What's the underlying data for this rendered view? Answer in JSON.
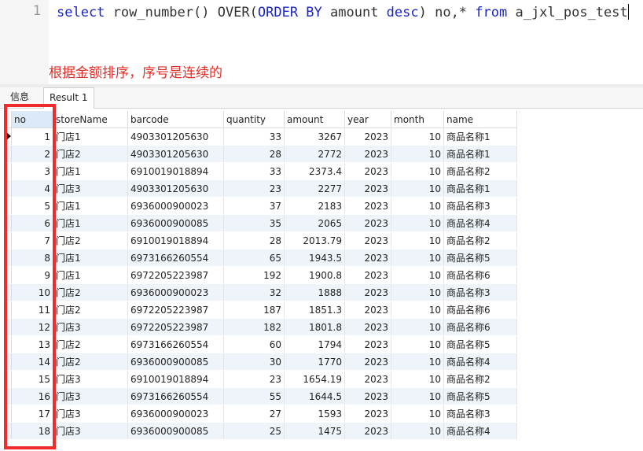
{
  "editor": {
    "line_number": "1",
    "code": {
      "t1": "select",
      "t2": " row_number() OVER(",
      "t3": "ORDER BY",
      "t4": " amount ",
      "t5": "desc",
      "t6": ") no,* ",
      "t7": "from",
      "t8": " a_jxl_pos_test"
    },
    "annotation": "根据金额排序，序号是连续的"
  },
  "tabs": {
    "info": "信息",
    "result": "Result 1"
  },
  "grid": {
    "columns": [
      "no",
      "storeName",
      "barcode",
      "quantity",
      "amount",
      "year",
      "month",
      "name"
    ],
    "rows": [
      [
        "1",
        "门店1",
        "4903301205630",
        "33",
        "3267",
        "2023",
        "10",
        "商品名称1"
      ],
      [
        "2",
        "门店2",
        "4903301205630",
        "28",
        "2772",
        "2023",
        "10",
        "商品名称1"
      ],
      [
        "3",
        "门店1",
        "6910019018894",
        "33",
        "2373.4",
        "2023",
        "10",
        "商品名称2"
      ],
      [
        "4",
        "门店3",
        "4903301205630",
        "23",
        "2277",
        "2023",
        "10",
        "商品名称1"
      ],
      [
        "5",
        "门店1",
        "6936000900023",
        "37",
        "2183",
        "2023",
        "10",
        "商品名称3"
      ],
      [
        "6",
        "门店1",
        "6936000900085",
        "35",
        "2065",
        "2023",
        "10",
        "商品名称4"
      ],
      [
        "7",
        "门店2",
        "6910019018894",
        "28",
        "2013.79",
        "2023",
        "10",
        "商品名称2"
      ],
      [
        "8",
        "门店1",
        "6973166260554",
        "65",
        "1943.5",
        "2023",
        "10",
        "商品名称5"
      ],
      [
        "9",
        "门店1",
        "6972205223987",
        "192",
        "1900.8",
        "2023",
        "10",
        "商品名称6"
      ],
      [
        "10",
        "门店2",
        "6936000900023",
        "32",
        "1888",
        "2023",
        "10",
        "商品名称3"
      ],
      [
        "11",
        "门店2",
        "6972205223987",
        "187",
        "1851.3",
        "2023",
        "10",
        "商品名称6"
      ],
      [
        "12",
        "门店3",
        "6972205223987",
        "182",
        "1801.8",
        "2023",
        "10",
        "商品名称6"
      ],
      [
        "13",
        "门店2",
        "6973166260554",
        "60",
        "1794",
        "2023",
        "10",
        "商品名称5"
      ],
      [
        "14",
        "门店2",
        "6936000900085",
        "30",
        "1770",
        "2023",
        "10",
        "商品名称4"
      ],
      [
        "15",
        "门店3",
        "6910019018894",
        "23",
        "1654.19",
        "2023",
        "10",
        "商品名称2"
      ],
      [
        "16",
        "门店3",
        "6973166260554",
        "55",
        "1644.5",
        "2023",
        "10",
        "商品名称5"
      ],
      [
        "17",
        "门店3",
        "6936000900023",
        "27",
        "1593",
        "2023",
        "10",
        "商品名称3"
      ],
      [
        "18",
        "门店3",
        "6936000900085",
        "25",
        "1475",
        "2023",
        "10",
        "商品名称4"
      ]
    ]
  },
  "colors": {
    "keyword": "#1a24c8",
    "annotation": "#e0302a",
    "highlight_box": "#ef2b2b",
    "alt_row": "#eef4fa",
    "no_header": "#dce9f7"
  }
}
